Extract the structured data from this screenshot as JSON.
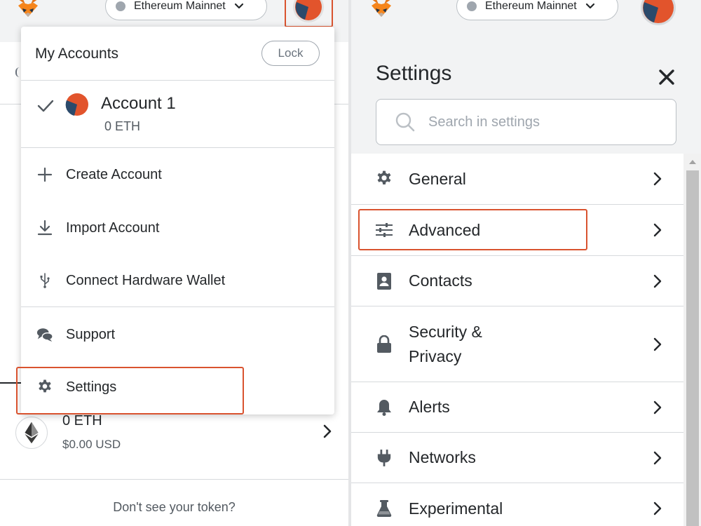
{
  "left_panel": {
    "network": "Ethereum Mainnet",
    "account_menu": {
      "title": "My Accounts",
      "lock_label": "Lock",
      "account": {
        "name": "Account 1",
        "balance": "0 ETH"
      },
      "items": [
        {
          "label": "Create Account",
          "icon": "plus-icon"
        },
        {
          "label": "Import Account",
          "icon": "download-icon"
        },
        {
          "label": "Connect Hardware Wallet",
          "icon": "usb-icon"
        },
        {
          "label": "Support",
          "icon": "chat-icon"
        },
        {
          "label": "Settings",
          "icon": "gear-icon"
        }
      ]
    },
    "asset": {
      "amount": "0 ETH",
      "fiat": "$0.00 USD"
    },
    "dont_see_token": "Don't see your token?",
    "highlight_color": "#d9532f"
  },
  "right_panel": {
    "network": "Ethereum Mainnet",
    "title": "Settings",
    "search": {
      "placeholder": "Search in settings",
      "value": ""
    },
    "items": [
      {
        "label": "General",
        "icon": "gear-icon"
      },
      {
        "label": "Advanced",
        "icon": "sliders-icon"
      },
      {
        "label": "Contacts",
        "icon": "contact-book-icon"
      },
      {
        "label": "Security & Privacy",
        "icon": "lock-icon"
      },
      {
        "label": "Alerts",
        "icon": "bell-icon"
      },
      {
        "label": "Networks",
        "icon": "plug-icon"
      },
      {
        "label": "Experimental",
        "icon": "flask-icon"
      }
    ]
  }
}
